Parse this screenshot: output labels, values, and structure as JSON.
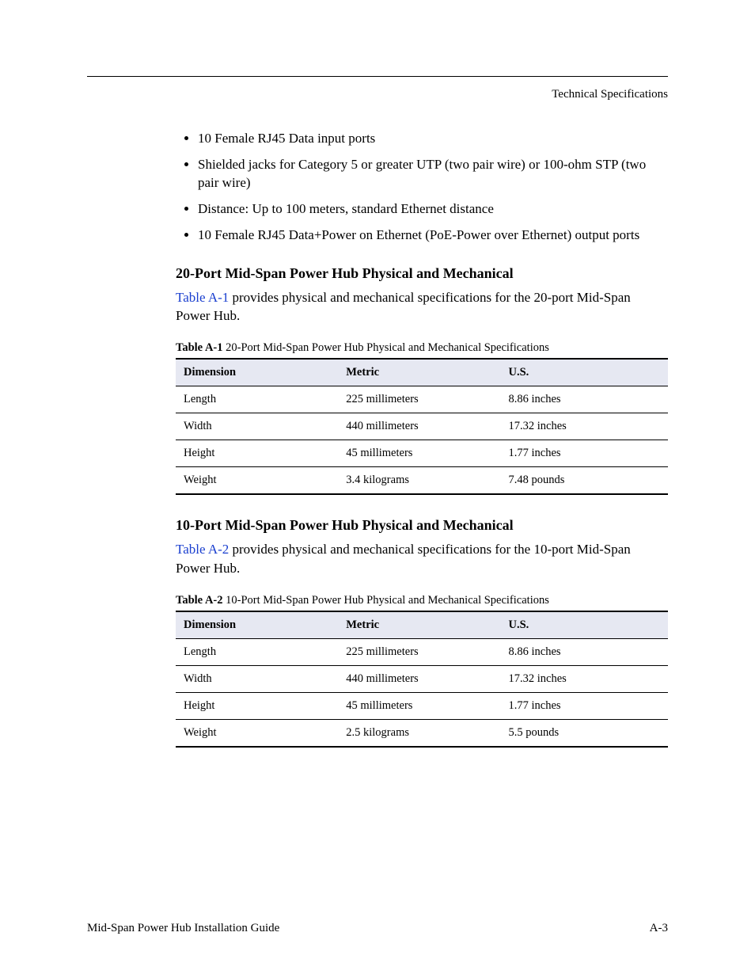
{
  "running_head": "Technical Specifications",
  "bullets": [
    "10 Female RJ45 Data input ports",
    "Shielded jacks for Category 5 or greater UTP (two pair wire) or 100-ohm STP (two pair wire)",
    "Distance: Up to 100 meters, standard Ethernet distance",
    "10 Female RJ45 Data+Power on Ethernet (PoE-Power over Ethernet) output ports"
  ],
  "section1": {
    "heading": "20-Port Mid-Span Power Hub Physical and Mechanical",
    "link_text": "Table A-1",
    "para_rest": " provides physical and mechanical specifications for the 20-port Mid-Span Power Hub.",
    "caption_label": "Table A-1",
    "caption_rest": "   20-Port Mid-Span Power Hub Physical and Mechanical Specifications",
    "cols": [
      "Dimension",
      "Metric",
      "U.S."
    ],
    "rows": [
      [
        "Length",
        "225 millimeters",
        "8.86 inches"
      ],
      [
        "Width",
        "440 millimeters",
        "17.32 inches"
      ],
      [
        "Height",
        "45 millimeters",
        "1.77 inches"
      ],
      [
        "Weight",
        "3.4 kilograms",
        "7.48 pounds"
      ]
    ]
  },
  "section2": {
    "heading": "10-Port Mid-Span Power Hub Physical and Mechanical",
    "link_text": "Table A-2",
    "para_rest": " provides physical and mechanical specifications for the 10-port Mid-Span Power Hub.",
    "caption_label": "Table A-2",
    "caption_rest": "   10-Port Mid-Span Power Hub Physical and Mechanical Specifications",
    "cols": [
      "Dimension",
      "Metric",
      "U.S."
    ],
    "rows": [
      [
        "Length",
        "225 millimeters",
        "8.86 inches"
      ],
      [
        "Width",
        "440 millimeters",
        "17.32 inches"
      ],
      [
        "Height",
        "45 millimeters",
        "1.77 inches"
      ],
      [
        "Weight",
        "2.5 kilograms",
        "5.5 pounds"
      ]
    ]
  },
  "footer": {
    "left": "Mid-Span Power Hub Installation Guide",
    "right": "A-3"
  }
}
